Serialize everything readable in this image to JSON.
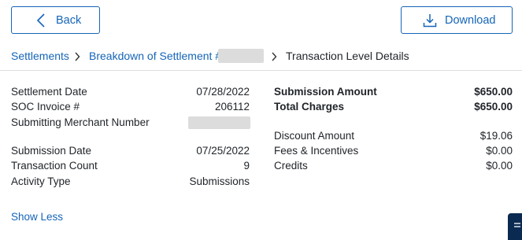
{
  "header": {
    "back_label": "Back",
    "download_label": "Download"
  },
  "breadcrumb": {
    "settlements": "Settlements",
    "breakdown": "Breakdown of Settlement #",
    "current": "Transaction Level Details"
  },
  "left_details": [
    {
      "label": "Settlement Date",
      "value": "07/28/2022"
    },
    {
      "label": "SOC Invoice #",
      "value": "206112"
    },
    {
      "label": "Submitting Merchant Number",
      "value": ""
    },
    {
      "label": "Submission Date",
      "value": "07/25/2022"
    },
    {
      "label": "Transaction Count",
      "value": "9"
    },
    {
      "label": "Activity Type",
      "value": "Submissions"
    }
  ],
  "right_details": [
    {
      "label": "Submission Amount",
      "value": "$650.00"
    },
    {
      "label": "Total Charges",
      "value": "$650.00"
    },
    {
      "label": "Discount Amount",
      "value": "$19.06"
    },
    {
      "label": "Fees & Incentives",
      "value": "$0.00"
    },
    {
      "label": "Credits",
      "value": "$0.00"
    }
  ],
  "show_less_label": "Show Less",
  "colors": {
    "accent": "#1565b8",
    "text": "#1f2328",
    "redaction": "#dcdcdc",
    "fab": "#0b2a52"
  },
  "icons": {
    "back": "chevron-left-icon",
    "download": "download-icon",
    "breadcrumb_separator": "chevron-right-icon"
  }
}
